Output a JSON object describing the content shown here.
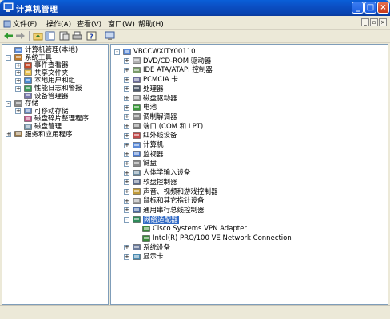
{
  "window": {
    "title": "计算机管理"
  },
  "menu": [
    {
      "label": "文件(F)"
    },
    {
      "label": "操作(A)"
    },
    {
      "label": "查看(V)"
    },
    {
      "label": "窗口(W)"
    },
    {
      "label": "帮助(H)"
    }
  ],
  "left_tree": [
    {
      "label": "计算机管理(本地)",
      "icon": "computer-management-icon",
      "expander": "none"
    },
    {
      "label": "系统工具",
      "icon": "tools-icon",
      "expander": "-"
    },
    {
      "label": "事件查看器",
      "icon": "event-viewer-icon",
      "expander": "+"
    },
    {
      "label": "共享文件夹",
      "icon": "shared-folder-icon",
      "expander": "+"
    },
    {
      "label": "本地用户和组",
      "icon": "users-icon",
      "expander": "+"
    },
    {
      "label": "性能日志和警报",
      "icon": "performance-icon",
      "expander": "+"
    },
    {
      "label": "设备管理器",
      "icon": "device-manager-icon",
      "expander": "none"
    },
    {
      "label": "存储",
      "icon": "storage-icon",
      "expander": "-"
    },
    {
      "label": "可移动存储",
      "icon": "removable-storage-icon",
      "expander": "+"
    },
    {
      "label": "磁盘碎片整理程序",
      "icon": "defrag-icon",
      "expander": "none"
    },
    {
      "label": "磁盘管理",
      "icon": "disk-management-icon",
      "expander": "none"
    },
    {
      "label": "服务和应用程序",
      "icon": "services-icon",
      "expander": "+"
    }
  ],
  "right_tree": [
    {
      "label": "VBCCWXITY00110",
      "icon": "computer-icon",
      "expander": "-"
    },
    {
      "label": "DVD/CD-ROM 驱动器",
      "icon": "cdrom-icon",
      "expander": "+"
    },
    {
      "label": "IDE ATA/ATAPI 控制器",
      "icon": "ide-controller-icon",
      "expander": "+"
    },
    {
      "label": "PCMCIA 卡",
      "icon": "pcmcia-icon",
      "expander": "+"
    },
    {
      "label": "处理器",
      "icon": "processor-icon",
      "expander": "+"
    },
    {
      "label": "磁盘驱动器",
      "icon": "disk-drive-icon",
      "expander": "+"
    },
    {
      "label": "电池",
      "icon": "battery-icon",
      "expander": "+"
    },
    {
      "label": "调制解调器",
      "icon": "modem-icon",
      "expander": "+"
    },
    {
      "label": "端口 (COM 和 LPT)",
      "icon": "port-icon",
      "expander": "+"
    },
    {
      "label": "红外线设备",
      "icon": "infrared-icon",
      "expander": "+"
    },
    {
      "label": "计算机",
      "icon": "computer-icon",
      "expander": "+"
    },
    {
      "label": "监视器",
      "icon": "monitor-icon",
      "expander": "+"
    },
    {
      "label": "键盘",
      "icon": "keyboard-icon",
      "expander": "+"
    },
    {
      "label": "人体学输入设备",
      "icon": "hid-icon",
      "expander": "+"
    },
    {
      "label": "软盘控制器",
      "icon": "floppy-controller-icon",
      "expander": "+"
    },
    {
      "label": "声音、视频和游戏控制器",
      "icon": "sound-icon",
      "expander": "+"
    },
    {
      "label": "鼠标和其它指针设备",
      "icon": "mouse-icon",
      "expander": "+"
    },
    {
      "label": "通用串行总线控制器",
      "icon": "usb-icon",
      "expander": "+"
    },
    {
      "label": "网络适配器",
      "icon": "network-adapter-icon",
      "expander": "-",
      "selected": true
    },
    {
      "label": "Cisco Systems VPN Adapter",
      "icon": "network-card-icon",
      "expander": "none",
      "child": true
    },
    {
      "label": "Intel(R) PRO/100 VE Network Connection",
      "icon": "network-card-icon",
      "expander": "none",
      "child": true
    },
    {
      "label": "系统设备",
      "icon": "system-devices-icon",
      "expander": "+"
    },
    {
      "label": "显示卡",
      "icon": "display-adapter-icon",
      "expander": "+"
    }
  ],
  "colors": {
    "title_bar": "#0b4fc4",
    "selection": "#316ac5",
    "pane_border": "#7f9db9"
  }
}
